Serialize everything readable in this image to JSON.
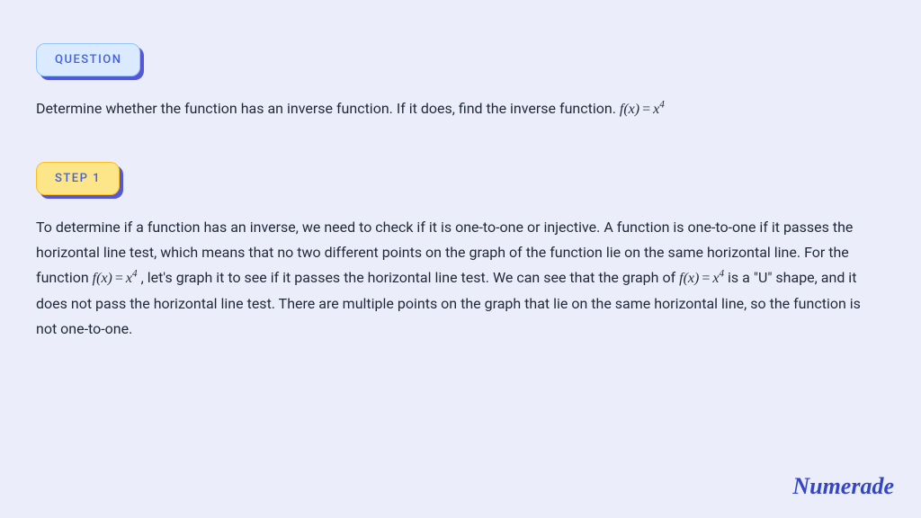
{
  "question": {
    "badge": "QUESTION",
    "text_before": "Determine whether the function has an inverse function. If it does, find the inverse function.  ",
    "math": "f(x) = x⁴"
  },
  "step": {
    "badge": "STEP 1",
    "part1": "To determine if a function has an inverse, we need to check if it is one-to-one or injective. A function is one-to-one if it passes the horizontal line test, which means that no two different points on the graph of the function lie on the same horizontal line. For the function ",
    "math1": "f(x) = x⁴",
    "part2": ", let's graph it to see if it passes the horizontal line test. We can see that the graph of ",
    "math2": "f(x) = x⁴",
    "part3": " is a \"U\" shape, and it does not pass the horizontal line test. There are multiple points on the graph that lie on the same horizontal line, so the function is not one-to-one."
  },
  "brand": "Numerade"
}
